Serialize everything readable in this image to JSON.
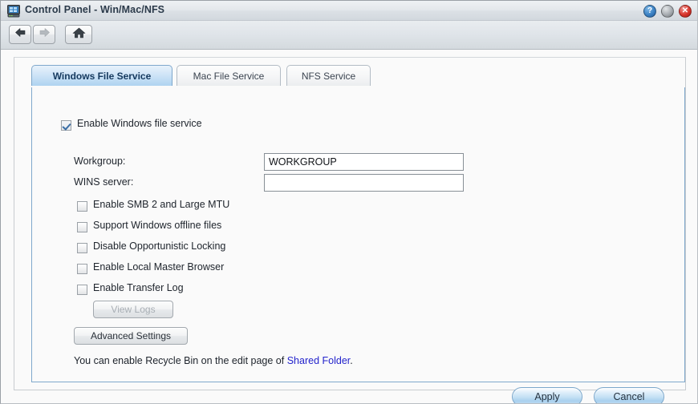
{
  "window": {
    "title": "Control Panel - Win/Mac/NFS",
    "app_icon": "server-monitor-icon",
    "controls": [
      {
        "name": "help",
        "glyph": "?",
        "color": "#3c82c4"
      },
      {
        "name": "minimize",
        "glyph": "",
        "color": "#a7acb1"
      },
      {
        "name": "close",
        "glyph": "✕",
        "color": "#d8352c"
      }
    ]
  },
  "nav": {
    "back": {
      "label": "Back",
      "icon": "arrow-left-icon",
      "enabled": true
    },
    "forward": {
      "label": "Forward",
      "icon": "arrow-right-icon",
      "enabled": false
    },
    "home": {
      "label": "Home",
      "icon": "home-icon",
      "enabled": true
    }
  },
  "tabs": [
    {
      "label": "Windows File Service",
      "active": true
    },
    {
      "label": "Mac File Service",
      "active": false
    },
    {
      "label": "NFS Service",
      "active": false
    }
  ],
  "form": {
    "enable_service": {
      "label": "Enable Windows file service",
      "checked": true
    },
    "fields": [
      {
        "label": "Workgroup:",
        "value": "WORKGROUP",
        "placeholder": ""
      },
      {
        "label": "WINS server:",
        "value": "",
        "placeholder": ""
      }
    ],
    "options": [
      {
        "label": "Enable SMB 2 and Large MTU",
        "checked": false
      },
      {
        "label": "Support Windows offline files",
        "checked": false
      },
      {
        "label": "Disable Opportunistic Locking",
        "checked": false
      },
      {
        "label": "Enable Local Master Browser",
        "checked": false
      },
      {
        "label": "Enable Transfer Log",
        "checked": false
      }
    ],
    "view_logs_button": {
      "label": "View Logs",
      "enabled": false
    },
    "advanced_button": {
      "label": "Advanced Settings",
      "enabled": true
    },
    "note": {
      "prefix": "You can enable Recycle Bin on the edit page of ",
      "link": "Shared Folder",
      "suffix": "."
    }
  },
  "actions": {
    "apply": "Apply",
    "cancel": "Cancel"
  },
  "colors": {
    "accent_blue": "#6f9fc6",
    "link_blue": "#2323cc",
    "titlebar_top": "#eef1f4",
    "panel_bg": "#fafafa"
  }
}
